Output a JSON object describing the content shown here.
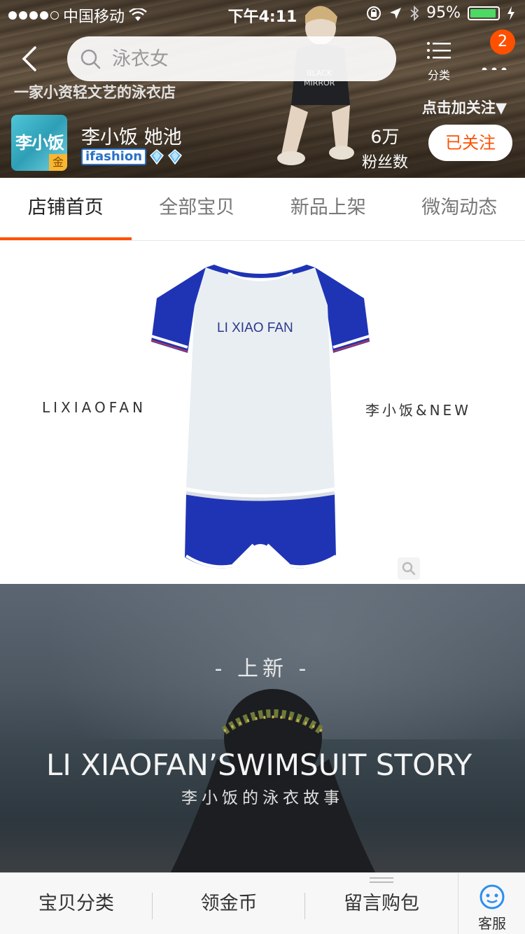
{
  "status_bar": {
    "carrier": "中国移动",
    "time": "下午4:11",
    "battery_percent": "95%",
    "battery_level": 0.95
  },
  "search": {
    "placeholder": "泳衣女"
  },
  "nav": {
    "category_label": "分类",
    "more_badge": "2"
  },
  "store": {
    "tagline": "一家小资轻文艺的泳衣店",
    "follow_hint": "点击加关注▼",
    "logo_text": "李小饭",
    "logo_gold": "金",
    "name": "李小饭 她池",
    "badge": "ifashion",
    "fans_count": "6万",
    "fans_label": "粉丝数",
    "follow_button": "已关注"
  },
  "tabs": [
    {
      "label": "店铺首页",
      "active": true
    },
    {
      "label": "全部宝贝",
      "active": false
    },
    {
      "label": "新品上架",
      "active": false
    },
    {
      "label": "微淘动态",
      "active": false
    }
  ],
  "product_banner": {
    "left_text": "LIXIAOFAN",
    "right_text": "李小饭&NEW",
    "shirt_text": "LI XIAO FAN"
  },
  "story_banner": {
    "new_label": "- 上新 -",
    "title": "LI XIAOFAN’SWIMSUIT STORY",
    "subtitle": "李小饭的泳衣故事"
  },
  "bottom_bar": {
    "items": [
      "宝贝分类",
      "领金币",
      "留言购包"
    ],
    "service_label": "客服"
  },
  "colors": {
    "accent": "#ff5000",
    "battery": "#4cd964",
    "ifashion_blue": "#2a72c9",
    "garment_blue": "#1f34b5"
  },
  "icons": [
    "back-icon",
    "search-icon",
    "list-icon",
    "more-icon",
    "wifi-icon",
    "location-icon",
    "bluetooth-icon",
    "lock-rotation-icon",
    "zoom-icon",
    "customer-service-icon"
  ]
}
